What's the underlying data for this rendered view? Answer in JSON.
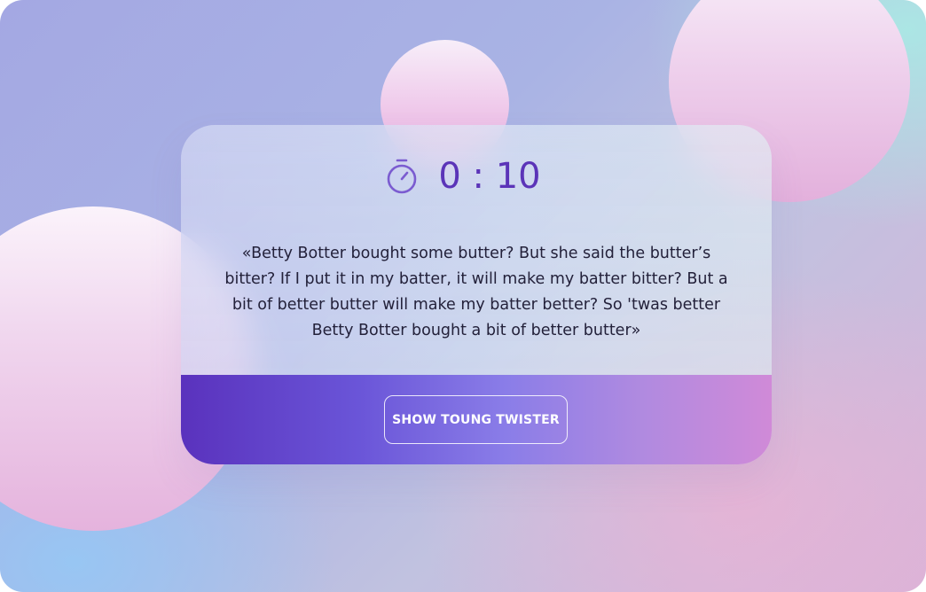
{
  "timer": {
    "icon": "stopwatch-icon",
    "value": "0 : 10"
  },
  "twister": {
    "text": "«Betty Botter bought some butter? But she said the butter’s bitter? If I put it in my batter, it will make my batter bitter? But a bit of better butter will make my batter better? So 'twas better Betty Botter bought a bit of better butter»"
  },
  "actions": {
    "show_label": "SHOW TOUNG TWISTER"
  },
  "colors": {
    "accent": "#5b34b8",
    "button_gradient_start": "#5a32bd",
    "button_gradient_end": "#d08ad8",
    "bubble_pink": "#e6acdc"
  }
}
